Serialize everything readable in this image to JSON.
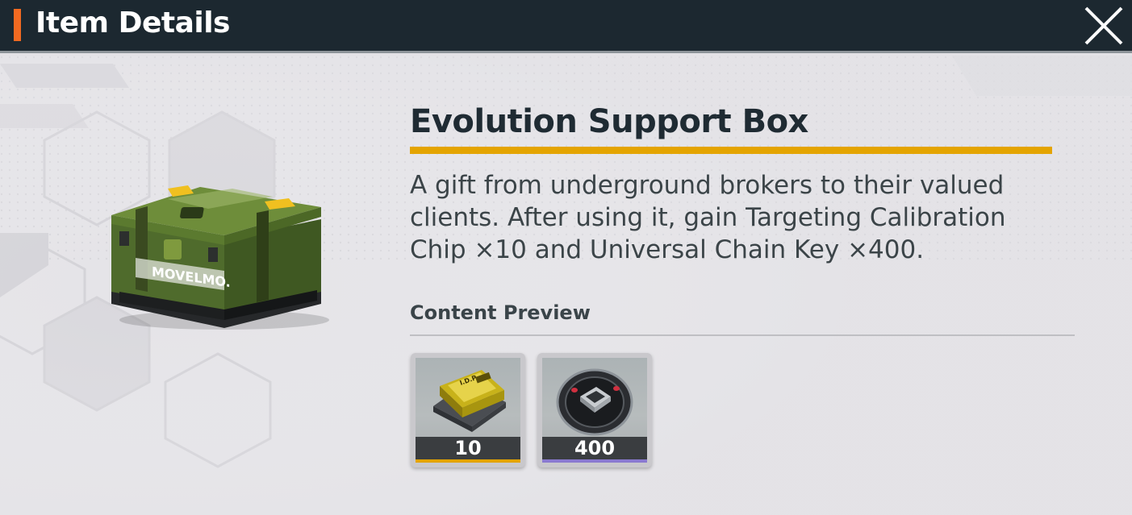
{
  "header": {
    "title": "Item Details",
    "accent_color": "#f26a21",
    "close_icon": "close-icon"
  },
  "item": {
    "name": "Evolution Support Box",
    "art_icon": "green-supply-box-icon",
    "art_text": "MOVELMO.",
    "description": "A gift from underground brokers to their valued clients. After using it, gain Targeting Calibration Chip ×10 and Universal Chain Key ×400.",
    "title_rule_color": "#e4a400"
  },
  "content_preview": {
    "label": "Content Preview",
    "items": [
      {
        "icon": "calibration-chip-icon",
        "quantity": "10",
        "rarity_color": "#e4a400"
      },
      {
        "icon": "chain-key-icon",
        "quantity": "400",
        "rarity_color": "#8a7ad0"
      }
    ]
  }
}
